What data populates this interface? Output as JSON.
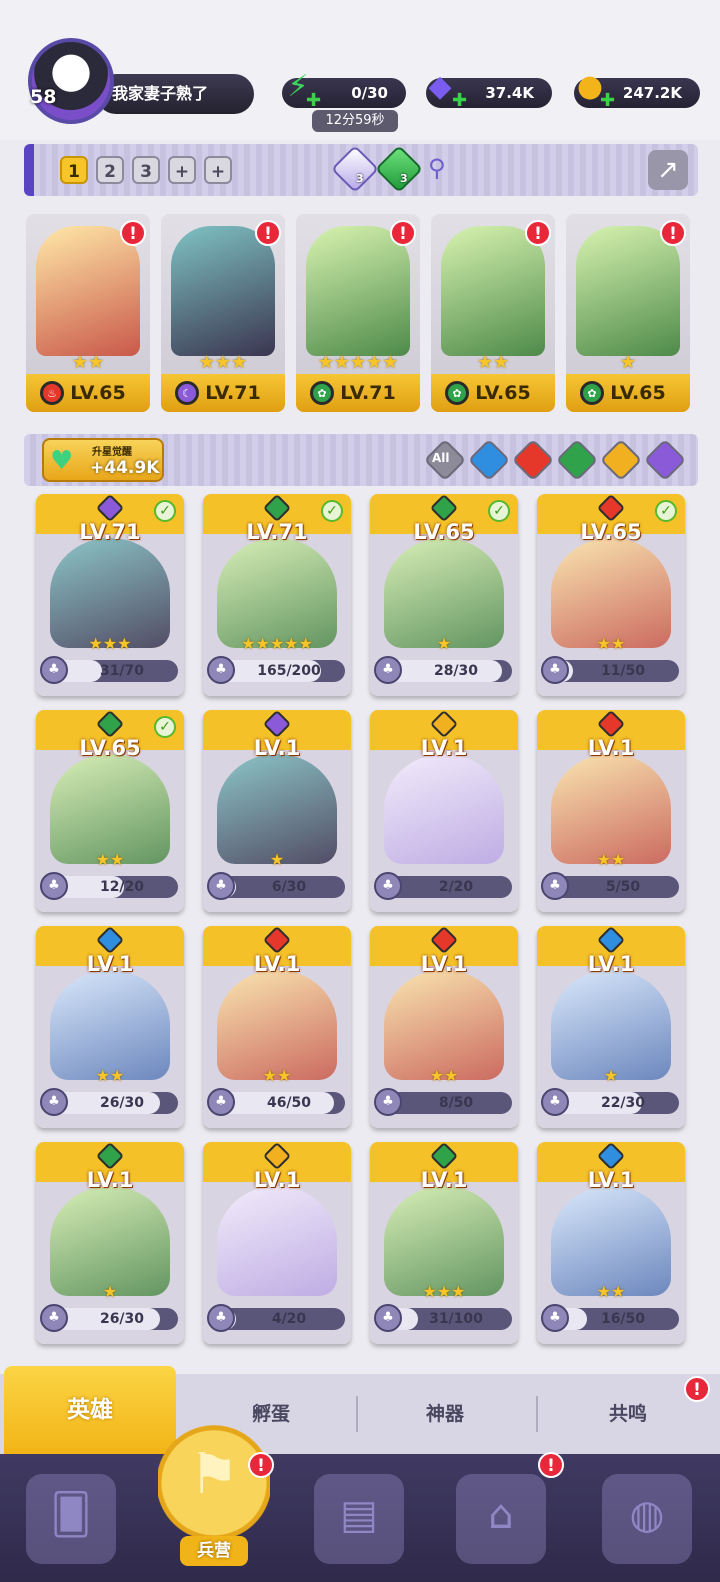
{
  "player": {
    "level": "58",
    "name": "我家妻子熟了"
  },
  "resources": {
    "energy": "0/30",
    "energy_timer": "12分59秒",
    "gems": "37.4K",
    "coins": "247.2K"
  },
  "team_bar": {
    "tabs": [
      "1",
      "2",
      "3",
      "+",
      "+"
    ],
    "active_tab": "1",
    "light_gem_count": "3",
    "nature_gem_count": "3"
  },
  "team": [
    {
      "level": "LV.65",
      "stars": "★★",
      "element": "fire",
      "alert": "!"
    },
    {
      "level": "LV.71",
      "stars": "★★★",
      "element": "dark",
      "alert": "!"
    },
    {
      "level": "LV.71",
      "stars": "★★★★★",
      "element": "nature",
      "alert": "!"
    },
    {
      "level": "LV.65",
      "stars": "★★",
      "element": "nature",
      "alert": "!"
    },
    {
      "level": "LV.65",
      "stars": "★",
      "element": "nature",
      "alert": "!"
    }
  ],
  "awaken": {
    "label": "升星觉醒",
    "value": "+44.9K"
  },
  "filters": {
    "all_label": "All",
    "elements": [
      "water",
      "fire",
      "nature",
      "light",
      "dark"
    ]
  },
  "colors": {
    "fire": "#e5372a",
    "dark": "#8a5ad8",
    "nature": "#2fa24a",
    "water": "#2f8ee0",
    "light": "#f0b020",
    "accent": "#f4c228"
  },
  "heroes": [
    {
      "level": "LV.71",
      "element": "dark",
      "stars": "★★★",
      "fragments": "31/70",
      "progress": 0.44,
      "checked": true
    },
    {
      "level": "LV.71",
      "element": "nature",
      "stars": "★★★★★",
      "fragments": "165/200",
      "progress": 0.82,
      "checked": true
    },
    {
      "level": "LV.65",
      "element": "nature",
      "stars": "★",
      "fragments": "28/30",
      "progress": 0.93,
      "checked": true
    },
    {
      "level": "LV.65",
      "element": "fire",
      "stars": "★★",
      "fragments": "11/50",
      "progress": 0.22,
      "checked": true
    },
    {
      "level": "LV.65",
      "element": "nature",
      "stars": "★★",
      "fragments": "12/20",
      "progress": 0.6,
      "checked": true
    },
    {
      "level": "LV.1",
      "element": "dark",
      "stars": "★",
      "fragments": "6/30",
      "progress": 0.2,
      "checked": false
    },
    {
      "level": "LV.1",
      "element": "light",
      "stars": "",
      "fragments": "2/20",
      "progress": 0.1,
      "checked": false
    },
    {
      "level": "LV.1",
      "element": "fire",
      "stars": "★★",
      "fragments": "5/50",
      "progress": 0.1,
      "checked": false
    },
    {
      "level": "LV.1",
      "element": "water",
      "stars": "★★",
      "fragments": "26/30",
      "progress": 0.87,
      "checked": false
    },
    {
      "level": "LV.1",
      "element": "fire",
      "stars": "★★",
      "fragments": "46/50",
      "progress": 0.92,
      "checked": false
    },
    {
      "level": "LV.1",
      "element": "fire",
      "stars": "★★",
      "fragments": "8/50",
      "progress": 0.16,
      "checked": false
    },
    {
      "level": "LV.1",
      "element": "water",
      "stars": "★",
      "fragments": "22/30",
      "progress": 0.73,
      "checked": false
    },
    {
      "level": "LV.1",
      "element": "nature",
      "stars": "★",
      "fragments": "26/30",
      "progress": 0.87,
      "checked": false
    },
    {
      "level": "LV.1",
      "element": "light",
      "stars": "",
      "fragments": "4/20",
      "progress": 0.2,
      "checked": false
    },
    {
      "level": "LV.1",
      "element": "nature",
      "stars": "★★★",
      "fragments": "31/100",
      "progress": 0.31,
      "checked": false
    },
    {
      "level": "LV.1",
      "element": "water",
      "stars": "★★",
      "fragments": "16/50",
      "progress": 0.32,
      "checked": false
    }
  ],
  "subtabs": {
    "heroes": "英雄",
    "eggs": "孵蛋",
    "artifacts": "神器",
    "resonance": "共鸣",
    "resonance_alert": "!"
  },
  "bottom_nav": {
    "barracks_label": "兵营",
    "barracks_alert": "!",
    "castle_alert": "!"
  }
}
